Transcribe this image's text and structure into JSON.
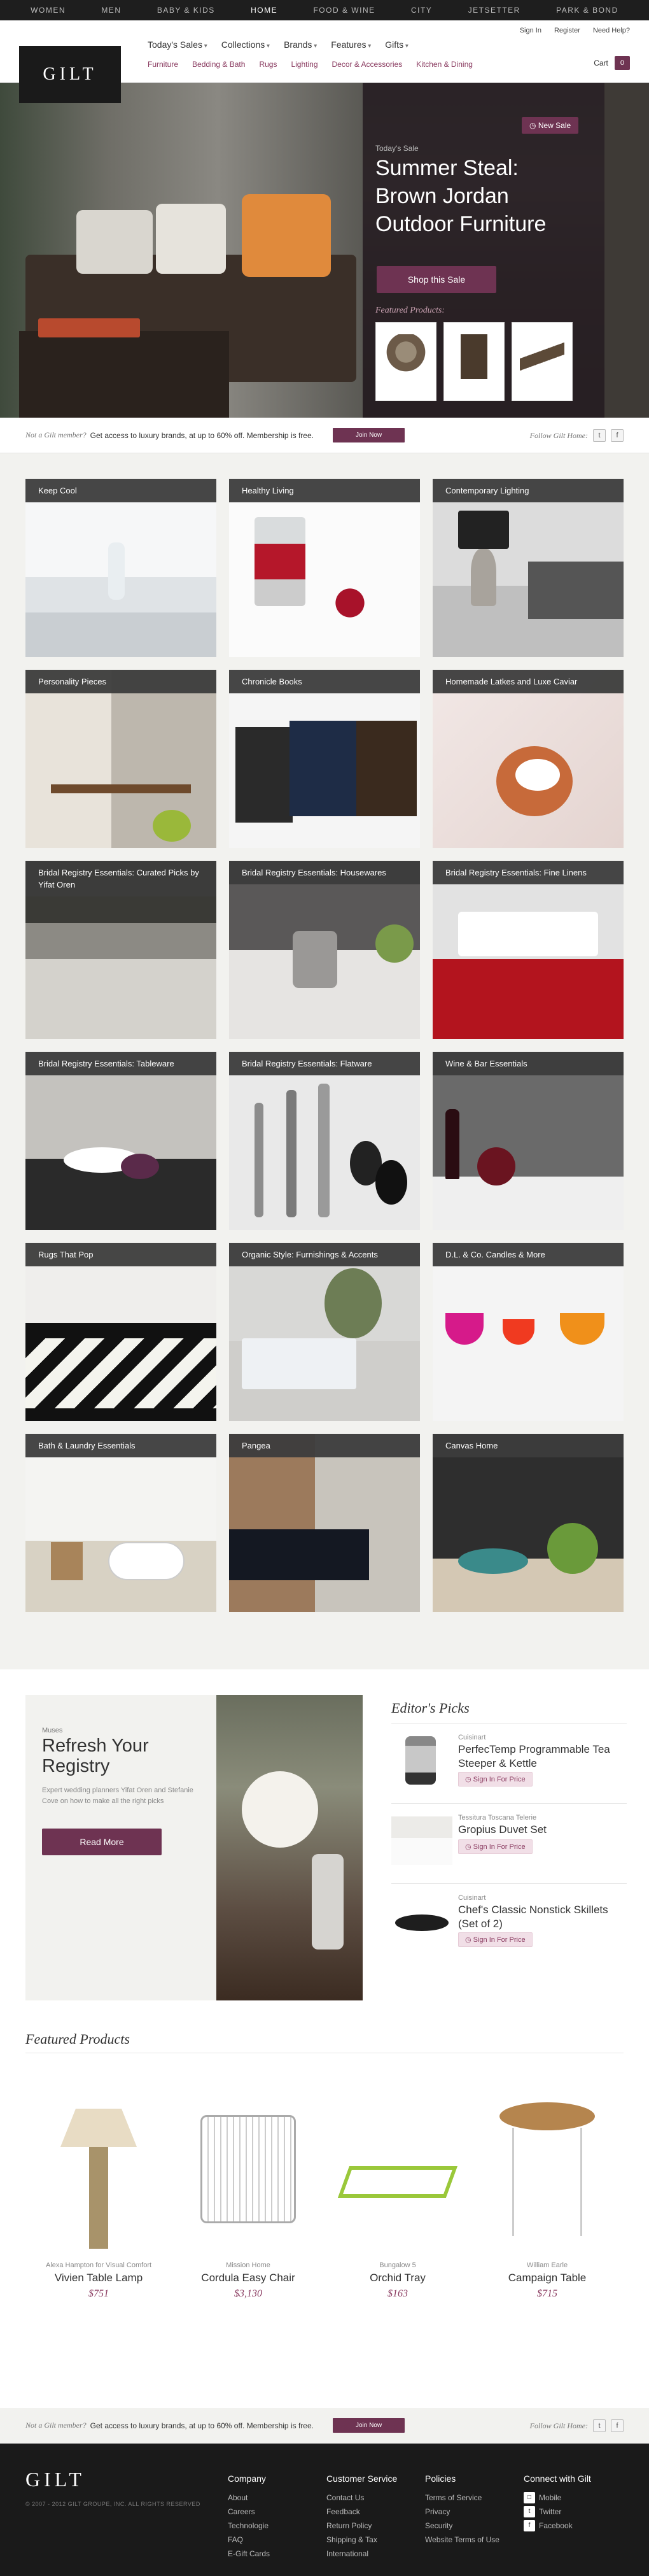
{
  "topnav": {
    "items": [
      "WOMEN",
      "MEN",
      "BABY & KIDS",
      "HOME",
      "FOOD & WINE",
      "CITY",
      "JETSETTER",
      "PARK & BOND"
    ],
    "active": "HOME"
  },
  "header": {
    "logo": "GILT",
    "account": [
      "Sign In",
      "Register",
      "Need Help?"
    ],
    "menu": [
      "Today's Sales",
      "Collections",
      "Brands",
      "Features",
      "Gifts"
    ],
    "submenu": [
      "Furniture",
      "Bedding & Bath",
      "Rugs",
      "Lighting",
      "Decor & Accessories",
      "Kitchen & Dining"
    ],
    "cart_label": "Cart",
    "cart_count": "0"
  },
  "hero": {
    "badge": "New Sale",
    "eyebrow": "Today's Sale",
    "title": "Summer Steal: Brown Jordan Outdoor Furniture",
    "cta": "Shop this Sale",
    "featured_label": "Featured Products:"
  },
  "member_bar": {
    "question": "Not a Gilt member?",
    "text": "Get access to luxury brands, at up to 60% off. Membership is free.",
    "join": "Join Now",
    "follow": "Follow Gilt Home:",
    "twitter": "t",
    "facebook": "f"
  },
  "tiles": [
    {
      "label": "Keep Cool"
    },
    {
      "label": "Healthy Living"
    },
    {
      "label": "Contemporary Lighting"
    },
    {
      "label": "Personality Pieces"
    },
    {
      "label": "Chronicle Books"
    },
    {
      "label": "Homemade Latkes and Luxe Caviar"
    },
    {
      "label": "Bridal Registry Essentials: Curated Picks by Yifat Oren"
    },
    {
      "label": "Bridal Registry Essentials: Housewares"
    },
    {
      "label": "Bridal Registry Essentials: Fine Linens"
    },
    {
      "label": "Bridal Registry Essentials: Tableware"
    },
    {
      "label": "Bridal Registry Essentials: Flatware"
    },
    {
      "label": "Wine & Bar Essentials"
    },
    {
      "label": "Rugs That Pop"
    },
    {
      "label": "Organic Style: Furnishings & Accents"
    },
    {
      "label": "D.L. & Co. Candles & More"
    },
    {
      "label": "Bath & Laundry Essentials"
    },
    {
      "label": "Pangea"
    },
    {
      "label": "Canvas Home"
    }
  ],
  "registry": {
    "eyebrow": "Muses",
    "title": "Refresh Your Registry",
    "body": "Expert wedding planners Yifat Oren and Stefanie Cove on how to make all the right picks",
    "cta": "Read More"
  },
  "editors": {
    "heading": "Editor's Picks",
    "items": [
      {
        "brand": "Cuisinart",
        "name": "PerfecTemp Programmable Tea Steeper & Kettle",
        "cta": "Sign In For Price"
      },
      {
        "brand": "Tessitura Toscana Telerie",
        "name": "Gropius Duvet Set",
        "cta": "Sign In For Price"
      },
      {
        "brand": "Cuisinart",
        "name": "Chef's Classic Nonstick Skillets (Set of 2)",
        "cta": "Sign In For Price"
      }
    ]
  },
  "featured": {
    "heading": "Featured Products",
    "items": [
      {
        "brand": "Alexa Hampton for Visual Comfort",
        "name": "Vivien Table Lamp",
        "price": "$751"
      },
      {
        "brand": "Mission Home",
        "name": "Cordula Easy Chair",
        "price": "$3,130"
      },
      {
        "brand": "Bungalow 5",
        "name": "Orchid Tray",
        "price": "$163"
      },
      {
        "brand": "William Earle",
        "name": "Campaign Table",
        "price": "$715"
      }
    ]
  },
  "footer": {
    "logo": "GILT",
    "copyright": "© 2007 - 2012 GILT GROUPE, INC. ALL RIGHTS RESERVED",
    "columns": [
      {
        "heading": "Company",
        "items": [
          "About",
          "Careers",
          "Technologie",
          "FAQ",
          "E-Gift Cards"
        ]
      },
      {
        "heading": "Customer Service",
        "items": [
          "Contact Us",
          "Feedback",
          "Return Policy",
          "Shipping & Tax",
          "International"
        ]
      },
      {
        "heading": "Policies",
        "items": [
          "Terms of Service",
          "Privacy",
          "Security",
          "Website Terms of Use"
        ]
      },
      {
        "heading": "Connect with Gilt",
        "items": [
          "Mobile",
          "Twitter",
          "Facebook"
        ]
      }
    ]
  },
  "colors": {
    "brand": "#6e3352",
    "dark": "#1a1a1a",
    "link": "#8a3b60"
  }
}
